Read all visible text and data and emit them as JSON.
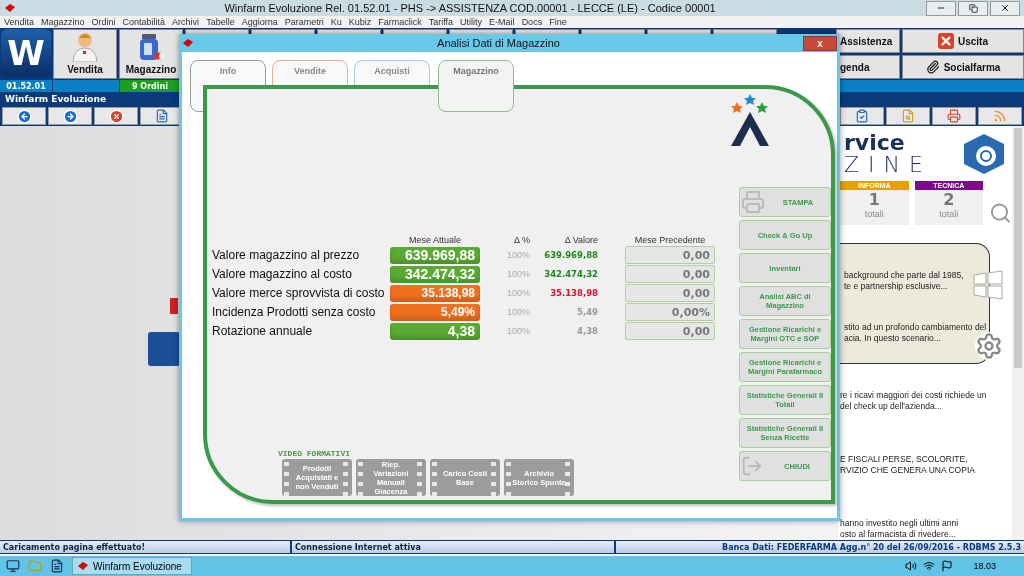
{
  "app": {
    "title": "Winfarm Evoluzione Rel. 01.52.01 - PHS -> ASSISTENZA COD.00001 - LECCE (LE) - Codice 00001",
    "menu": [
      "Vendita",
      "Magazzino",
      "Ordini",
      "Contabilità",
      "Archivi",
      "Tabelle",
      "Aggiorna",
      "Parametri",
      "Ku",
      "Kubiz",
      "Farmaclick",
      "Tariffa",
      "Utility",
      "E-Mail",
      "Docs",
      "Fine"
    ],
    "logo_letter": "W",
    "toolbar_left": [
      {
        "label": "Vendita",
        "kind": "person"
      },
      {
        "label": "Magazzino",
        "kind": "jar"
      }
    ],
    "toolbar_right": [
      {
        "label": "Assistenza",
        "kind": "plain"
      },
      {
        "label": "Uscita",
        "kind": "exit"
      },
      {
        "label": "genda",
        "kind": "plain"
      },
      {
        "label": "Socialfarma",
        "kind": "clip"
      }
    ],
    "info_bar": {
      "version": "01.52.01",
      "orders": "9 Ordini"
    },
    "section_title": "Winfarm Evoluzione"
  },
  "news": {
    "brand": [
      "rvice",
      "ZINE"
    ],
    "counters": [
      {
        "label": "INFORMA",
        "count": "1",
        "unit": "totali",
        "color": "#e6a000"
      },
      {
        "label": "TECNICA",
        "count": "2",
        "unit": "totali",
        "color": "#7a0a8a"
      }
    ],
    "card_paragraphs": [
      [
        "background che parte dal 1985,",
        "te e partnership esclusive..."
      ],
      [
        "stito ad un profondo cambiamento del",
        "acia. In questo scenario..."
      ]
    ],
    "paragraphs": [
      [
        "re i ricavi maggiori dei costi richiede un",
        "del check up dell'azienda..."
      ],
      [
        "E FISCALI PERSE, SCOLORITE,",
        "RVIZIO CHE GENERA UNA COPIA"
      ],
      [
        "hanno investito negli ultimi anni",
        "osto al farmacista di rivedere..."
      ]
    ]
  },
  "dialog": {
    "title": "Analisi Dati di Magazzino",
    "close": "x",
    "tabs": [
      {
        "label": "Info",
        "selected": false,
        "color": "#9a9a9a"
      },
      {
        "label": "Vendite",
        "selected": false,
        "color": "#e8b090"
      },
      {
        "label": "Acquisti",
        "selected": false,
        "color": "#a8c8e8"
      },
      {
        "label": "Magazzino",
        "selected": true,
        "color": "#8ac08a"
      }
    ],
    "columns": [
      "Mese Attuale",
      "Δ %",
      "Δ Valore",
      "Mese Precedente"
    ],
    "rows": [
      {
        "label": "Valore magazzino al prezzo",
        "current": "639.969,88",
        "color": "#5aaa34",
        "pct": "100%",
        "delta": {
          "text": "639.969,88",
          "color": "#1a8a1a"
        },
        "previous": "0,00"
      },
      {
        "label": "Valore magazzino al costo",
        "current": "342.474,32",
        "color": "#5aaa34",
        "pct": "100%",
        "delta": {
          "text": "342.474,32",
          "color": "#1a8a1a"
        },
        "previous": "0,00"
      },
      {
        "label": "Valore merce sprovvista di costo",
        "current": "35.138,98",
        "color": "#f07020",
        "pct": "100%",
        "delta": {
          "text": "35.138,98",
          "color": "#e01030"
        },
        "previous": "0,00"
      },
      {
        "label": "Incidenza Prodotti senza costo",
        "current": "5,49%",
        "color": "#f07020",
        "pct": "100%",
        "delta": {
          "text": "5,49",
          "color": "#9a9a9a"
        },
        "previous": "0,00%"
      },
      {
        "label": "Rotazione annuale",
        "current": "4,38",
        "color": "#5aaa34",
        "pct": "100%",
        "delta": {
          "text": "4,38",
          "color": "#9a9a9a"
        },
        "previous": "0,00"
      }
    ],
    "buttons": [
      {
        "label": "STAMPA",
        "kind": "print"
      },
      {
        "label": "Check & Go Up",
        "kind": "text"
      },
      {
        "label": "Inventari",
        "kind": "text"
      },
      {
        "label": "Analisi ABC di Magazzino",
        "kind": "text"
      },
      {
        "label": "Gestione Ricarichi e Margini OTC e SOP",
        "kind": "text"
      },
      {
        "label": "Gestione Ricarichi e Margini Parafarmaco",
        "kind": "text"
      },
      {
        "label": "Statistiche Generali II Totali",
        "kind": "text"
      },
      {
        "label": "Statistiche Generali II Senza Ricette",
        "kind": "text"
      },
      {
        "label": "CHIUDI",
        "kind": "exit"
      }
    ],
    "video": {
      "title": "VIDEO FORMATIVI",
      "items": [
        "Prodotti Acquistati e non Venduti",
        "Riep. Variazioni Manuali Giacenza",
        "Carico Costi Base",
        "Archivio Storico Spunte"
      ]
    }
  },
  "status_bar": [
    "Caricamento pagina effettuato!",
    "Connessione Internet attiva",
    "Banca Dati: FEDERFARMA Agg.n° 20 del 26/09/2016 - RDBMS 2.5.3"
  ],
  "taskbar": {
    "app": "Winfarm Evoluzione",
    "clock": "18.03"
  }
}
